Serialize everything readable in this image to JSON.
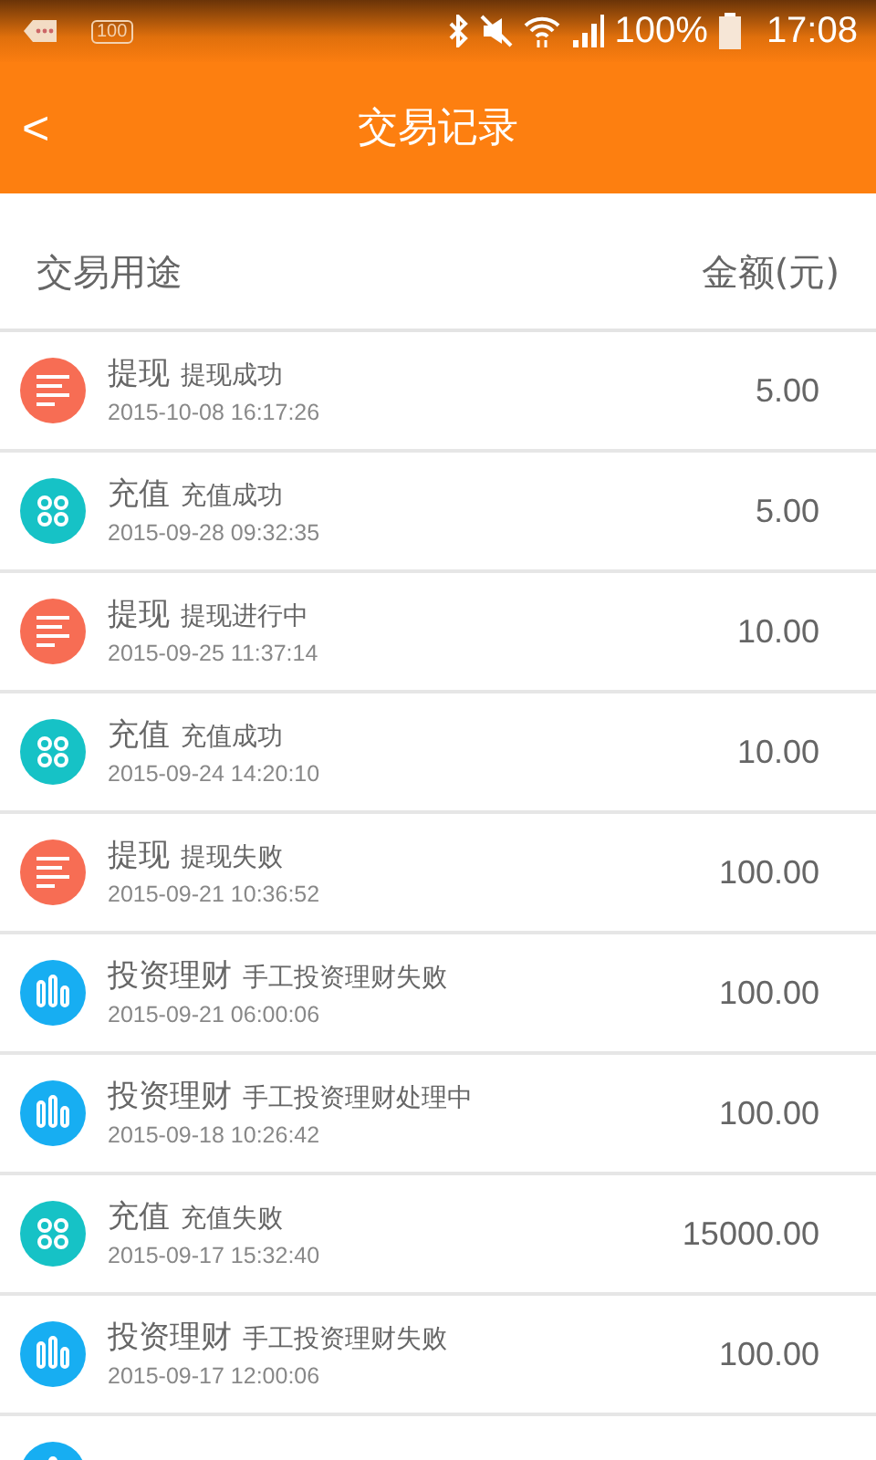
{
  "status_bar": {
    "battery_percent": "100%",
    "time": "17:08",
    "notification_badge": "100"
  },
  "header": {
    "back": "<",
    "title": "交易记录"
  },
  "columns": {
    "purpose": "交易用途",
    "amount": "金额(元)"
  },
  "transactions": [
    {
      "kind": "withdraw",
      "type": "提现",
      "status": "提现成功",
      "time": "2015-10-08 16:17:26",
      "amount": "5.00"
    },
    {
      "kind": "recharge",
      "type": "充值",
      "status": "充值成功",
      "time": "2015-09-28 09:32:35",
      "amount": "5.00"
    },
    {
      "kind": "withdraw",
      "type": "提现",
      "status": "提现进行中",
      "time": "2015-09-25 11:37:14",
      "amount": "10.00"
    },
    {
      "kind": "recharge",
      "type": "充值",
      "status": "充值成功",
      "time": "2015-09-24 14:20:10",
      "amount": "10.00"
    },
    {
      "kind": "withdraw",
      "type": "提现",
      "status": "提现失败",
      "time": "2015-09-21 10:36:52",
      "amount": "100.00"
    },
    {
      "kind": "invest",
      "type": "投资理财",
      "status": "手工投资理财失败",
      "time": "2015-09-21 06:00:06",
      "amount": "100.00"
    },
    {
      "kind": "invest",
      "type": "投资理财",
      "status": "手工投资理财处理中",
      "time": "2015-09-18 10:26:42",
      "amount": "100.00"
    },
    {
      "kind": "recharge",
      "type": "充值",
      "status": "充值失败",
      "time": "2015-09-17 15:32:40",
      "amount": "15000.00"
    },
    {
      "kind": "invest",
      "type": "投资理财",
      "status": "手工投资理财失败",
      "time": "2015-09-17 12:00:06",
      "amount": "100.00"
    },
    {
      "kind": "invest"
    }
  ]
}
